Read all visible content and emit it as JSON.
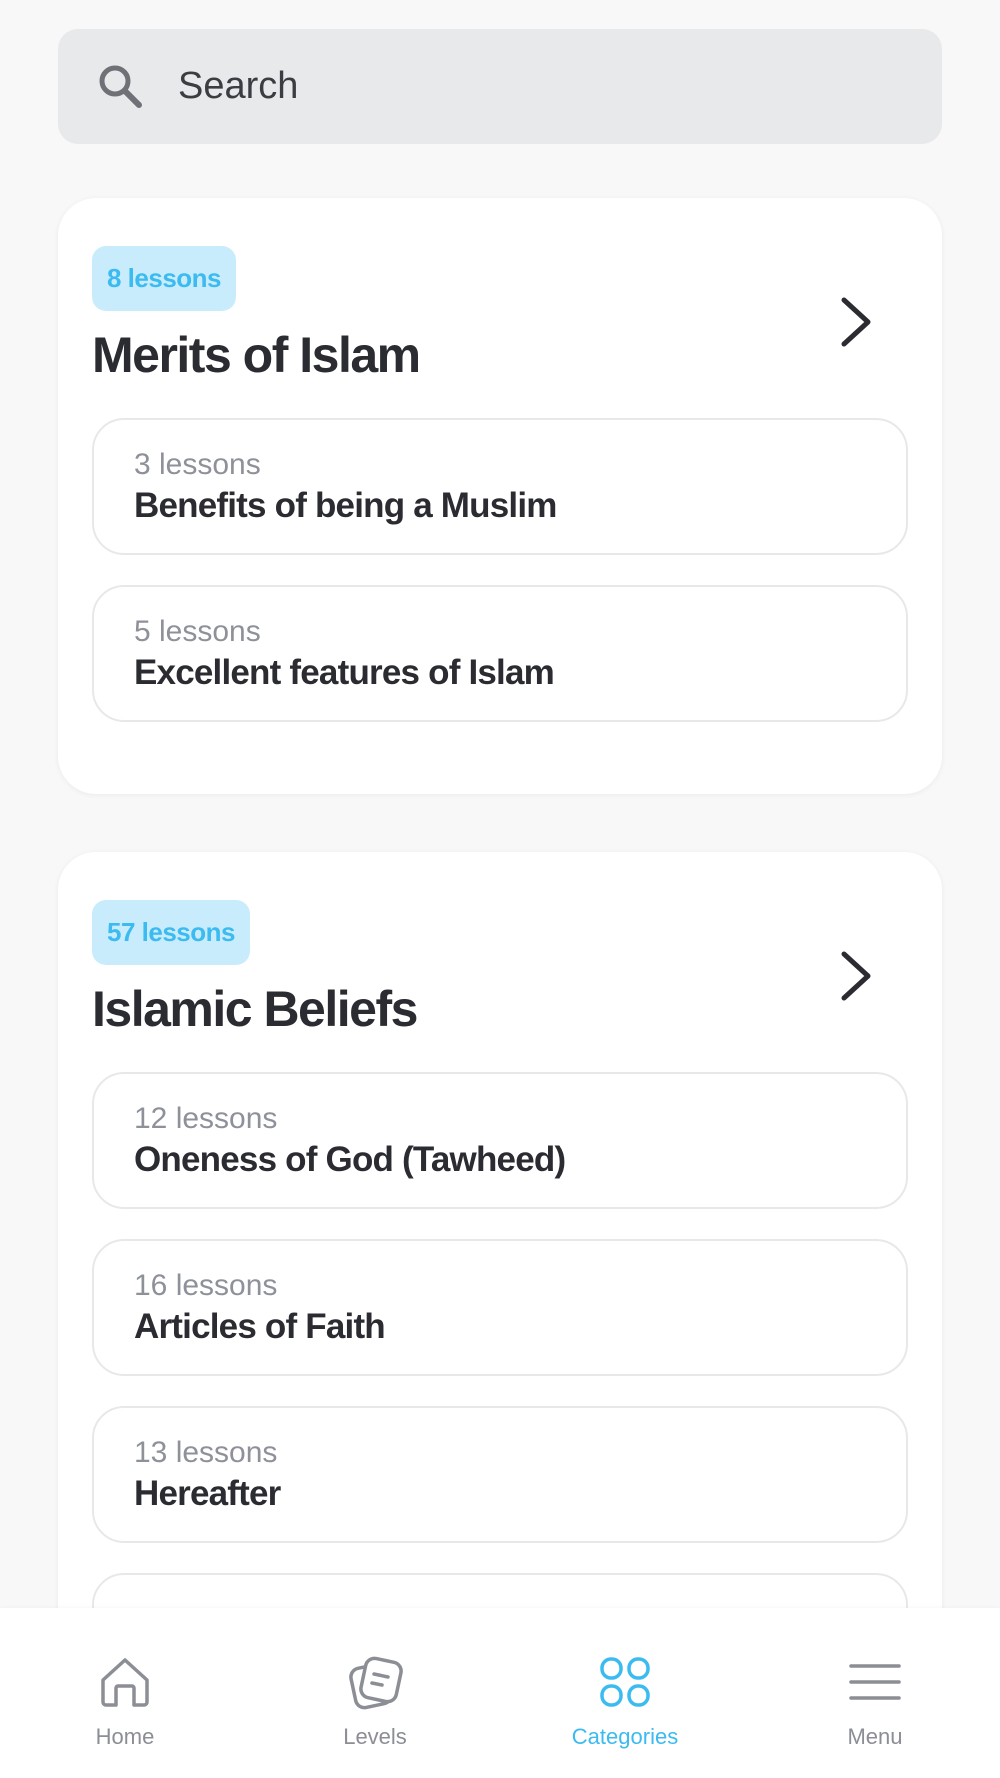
{
  "search": {
    "placeholder": "Search"
  },
  "categories": [
    {
      "badge": "8 lessons",
      "title": "Merits of Islam",
      "items": [
        {
          "count": "3 lessons",
          "name": "Benefits of being a Muslim"
        },
        {
          "count": "5 lessons",
          "name": "Excellent features of Islam"
        }
      ]
    },
    {
      "badge": "57 lessons",
      "title": "Islamic Beliefs",
      "items": [
        {
          "count": "12 lessons",
          "name": "Oneness of God (Tawheed)"
        },
        {
          "count": "16 lessons",
          "name": "Articles of Faith"
        },
        {
          "count": "13 lessons",
          "name": "Hereafter"
        }
      ]
    }
  ],
  "tabbar": {
    "tabs": [
      {
        "label": "Home",
        "icon": "home-icon",
        "active": false
      },
      {
        "label": "Levels",
        "icon": "levels-icon",
        "active": false
      },
      {
        "label": "Categories",
        "icon": "categories-icon",
        "active": true
      },
      {
        "label": "Menu",
        "icon": "menu-icon",
        "active": false
      }
    ]
  },
  "colors": {
    "accent": "#3bbbf0",
    "badge_bg": "#c9ecfc",
    "text": "#2b2c31",
    "muted": "#8e9199",
    "background": "#f8f8f8"
  }
}
